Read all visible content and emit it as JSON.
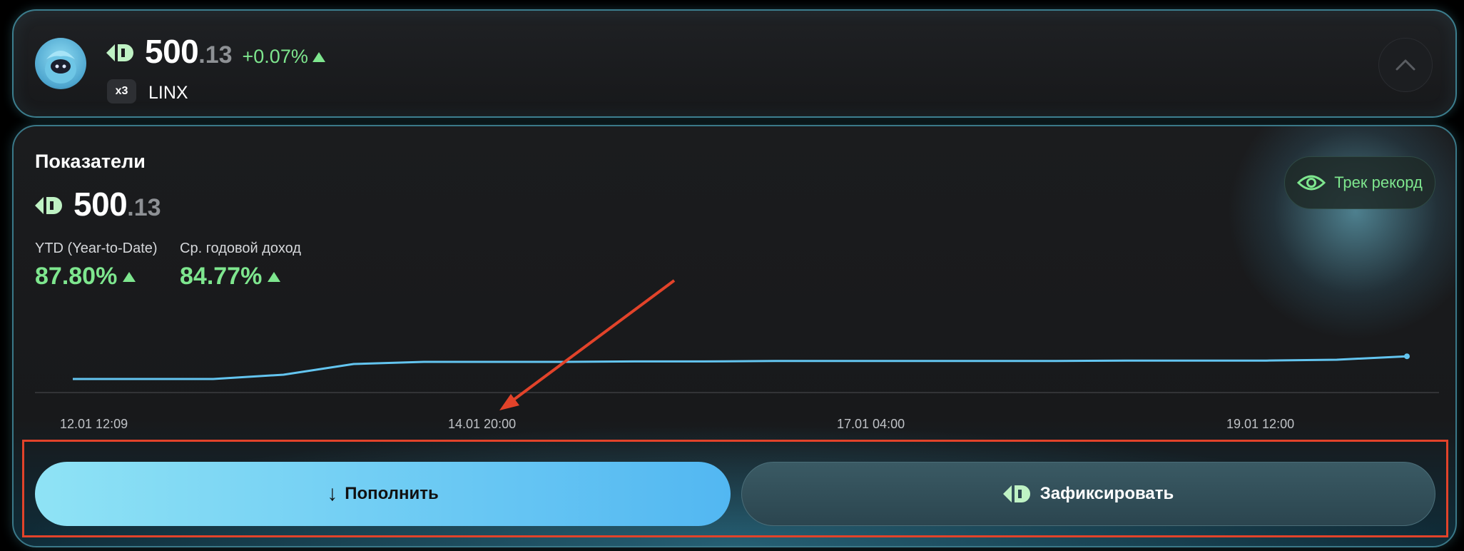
{
  "top": {
    "price_int": "500",
    "price_dec": ".13",
    "change": "+0.07%",
    "multiplier": "x3",
    "ticker": "LINX"
  },
  "card": {
    "title": "Показатели",
    "price_int": "500",
    "price_dec": ".13",
    "track_label": "Трек рекорд",
    "stats": [
      {
        "label": "YTD (Year-to-Date)",
        "value": "87.80%"
      },
      {
        "label": "Ср. годовой доход",
        "value": "84.77%"
      }
    ]
  },
  "chart_data": {
    "type": "line",
    "x": [
      "12.01 12:09",
      "12.01 22:00",
      "13.01 08:00",
      "13.01 18:00",
      "14.01 04:00",
      "14.01 14:00",
      "14.01 20:00",
      "15.01 06:00",
      "15.01 16:00",
      "16.01 02:00",
      "16.01 12:00",
      "17.01 04:00",
      "17.01 14:00",
      "18.01 00:00",
      "18.01 10:00",
      "18.01 20:00",
      "19.01 06:00",
      "19.01 12:00",
      "19.01 22:00",
      "20.01 02:00"
    ],
    "values": [
      499.6,
      499.6,
      499.6,
      499.7,
      499.95,
      500.0,
      500.0,
      500.0,
      500.01,
      500.01,
      500.02,
      500.02,
      500.02,
      500.02,
      500.02,
      500.03,
      500.03,
      500.03,
      500.05,
      500.13
    ],
    "tick_labels": [
      "12.01 12:09",
      "14.01 20:00",
      "17.01 04:00",
      "19.01 12:00"
    ],
    "ylim": [
      498.5,
      501.0
    ],
    "grid": false,
    "line_color": "#63c5f0"
  },
  "actions": {
    "deposit_label": "Пополнить",
    "fix_label": "Зафиксировать"
  },
  "colors": {
    "positive": "#7ee68e",
    "accent": "#52b7f2",
    "annotation": "#e2432a"
  }
}
